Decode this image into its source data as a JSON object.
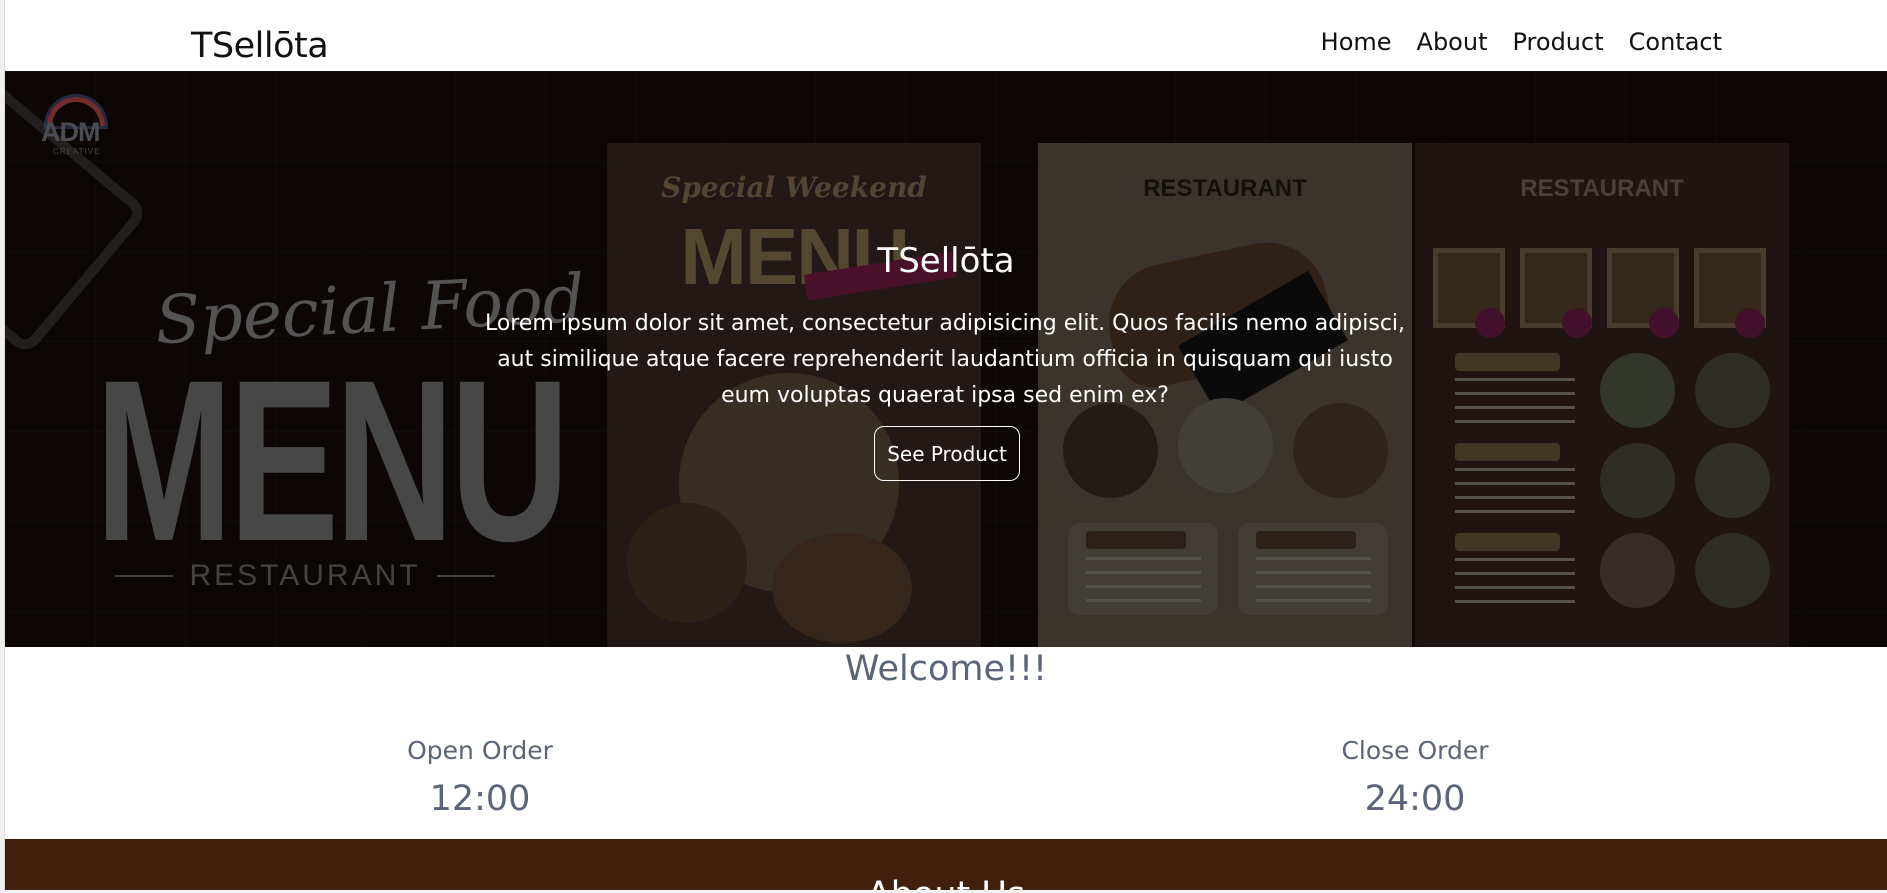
{
  "brand": "TSellōta",
  "nav": [
    "Home",
    "About",
    "Product",
    "Contact"
  ],
  "hero": {
    "bg_logo": "ADM",
    "bg_logo_sub": "CREATIVE",
    "bg_special": "Special Food",
    "bg_menu": "MENU",
    "bg_restaurant": "RESTAURANT",
    "poster1_top": "Special Weekend",
    "poster1_main": "MENU",
    "poster2_top": "RESTAURANT",
    "poster3_top": "RESTAURANT",
    "title": "TSellōta",
    "description": "Lorem ipsum dolor sit amet, consectetur adipisicing elit. Quos facilis nemo adipisci, aut similique atque facere reprehenderit laudantium officia in quisquam qui iusto eum voluptas quaerat ipsa sed enim ex?",
    "button": "See Product"
  },
  "welcome": "Welcome!!!",
  "hours": {
    "open_label": "Open Order",
    "open_time": "12:00",
    "close_label": "Close Order",
    "close_time": "24:00"
  },
  "about_title": "About Us",
  "colors": {
    "nav_text": "#111111",
    "muted_blue": "#5b6478",
    "about_bg": "#40200c"
  }
}
